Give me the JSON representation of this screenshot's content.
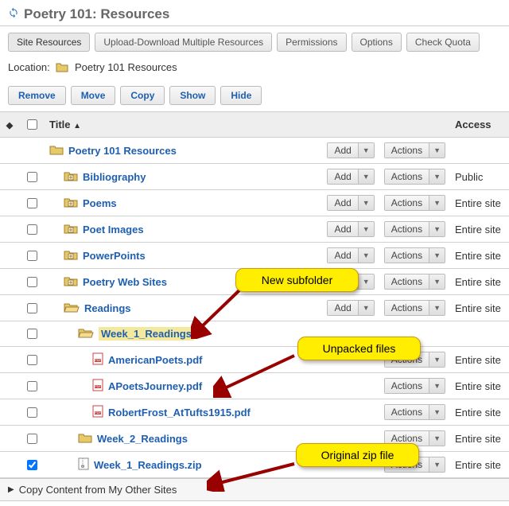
{
  "header": {
    "title": "Poetry 101: Resources"
  },
  "toolbar": [
    {
      "label": "Site Resources",
      "active": true
    },
    {
      "label": "Upload-Download Multiple Resources"
    },
    {
      "label": "Permissions"
    },
    {
      "label": "Options"
    },
    {
      "label": "Check Quota"
    }
  ],
  "location": {
    "prefix": "Location:",
    "path": "Poetry 101 Resources"
  },
  "actions": [
    {
      "label": "Remove"
    },
    {
      "label": "Move"
    },
    {
      "label": "Copy"
    },
    {
      "label": "Show"
    },
    {
      "label": "Hide"
    }
  ],
  "columns": {
    "title": "Title",
    "access": "Access"
  },
  "buttons": {
    "add": "Add",
    "actions": "Actions"
  },
  "rows": [
    {
      "indent": 0,
      "icon": "folder",
      "title": "Poetry 101 Resources",
      "add": true,
      "actions": true,
      "access": "",
      "chk": false,
      "hl": false
    },
    {
      "indent": 1,
      "icon": "folder-plus",
      "title": "Bibliography",
      "add": true,
      "actions": true,
      "access": "Public",
      "chk": true,
      "hl": false
    },
    {
      "indent": 1,
      "icon": "folder-plus",
      "title": "Poems",
      "add": true,
      "actions": true,
      "access": "Entire site",
      "chk": true,
      "hl": false
    },
    {
      "indent": 1,
      "icon": "folder-plus",
      "title": "Poet Images",
      "add": true,
      "actions": true,
      "access": "Entire site",
      "chk": true,
      "hl": false
    },
    {
      "indent": 1,
      "icon": "folder-plus",
      "title": "PowerPoints",
      "add": true,
      "actions": true,
      "access": "Entire site",
      "chk": true,
      "hl": false
    },
    {
      "indent": 1,
      "icon": "folder-plus",
      "title": "Poetry Web Sites",
      "add": true,
      "actions": true,
      "access": "Entire site",
      "chk": true,
      "hl": false
    },
    {
      "indent": 1,
      "icon": "folder-open",
      "title": "Readings",
      "add": true,
      "actions": true,
      "access": "Entire site",
      "chk": true,
      "hl": false
    },
    {
      "indent": 2,
      "icon": "folder-open",
      "title": "Week_1_Readings",
      "add": false,
      "actions": false,
      "access": "",
      "chk": true,
      "hl": true
    },
    {
      "indent": 3,
      "icon": "pdf",
      "title": "AmericanPoets.pdf",
      "add": false,
      "actions": true,
      "access": "Entire site",
      "chk": true,
      "hl": false
    },
    {
      "indent": 3,
      "icon": "pdf",
      "title": "APoetsJourney.pdf",
      "add": false,
      "actions": true,
      "access": "Entire site",
      "chk": true,
      "hl": false
    },
    {
      "indent": 3,
      "icon": "pdf",
      "title": "RobertFrost_AtTufts1915.pdf",
      "add": false,
      "actions": true,
      "access": "Entire site",
      "chk": true,
      "hl": false
    },
    {
      "indent": 2,
      "icon": "folder",
      "title": "Week_2_Readings",
      "add": false,
      "actions": true,
      "access": "Entire site",
      "chk": true,
      "hl": false
    },
    {
      "indent": 2,
      "icon": "zip",
      "title": "Week_1_Readings.zip",
      "add": false,
      "actions": true,
      "access": "Entire site",
      "chk": true,
      "checked": true,
      "hl": false
    }
  ],
  "callouts": {
    "new_subfolder": "New subfolder",
    "unpacked_files": "Unpacked files",
    "original_zip": "Original zip file"
  },
  "footer": {
    "label": "Copy Content from My Other Sites"
  }
}
